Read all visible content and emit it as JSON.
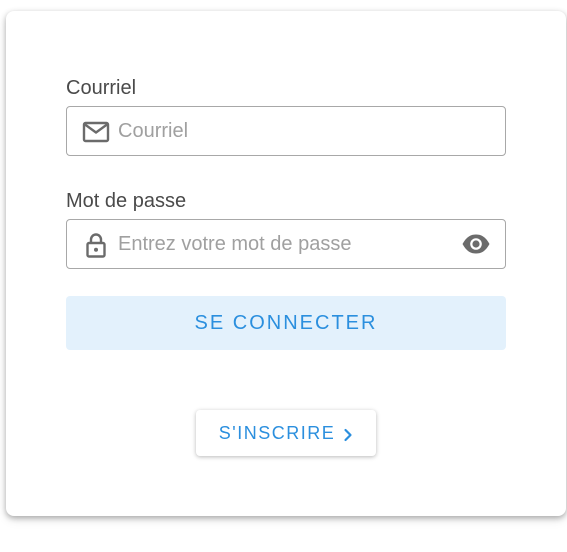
{
  "email": {
    "label": "Courriel",
    "placeholder": "Courriel",
    "value": "",
    "icon": "mail-icon"
  },
  "password": {
    "label": "Mot de passe",
    "placeholder": "Entrez votre mot de passe",
    "value": "",
    "icon": "lock-icon",
    "toggle_icon": "eye-icon"
  },
  "login_button": {
    "label": "SE CONNECTER"
  },
  "signup_button": {
    "label": "S'INSCRIRE",
    "icon": "chevron-right-icon"
  },
  "colors": {
    "accent": "#2b8fde",
    "primary_button_bg": "#e3f1fc",
    "icon": "#6b6b6b",
    "border": "#a8a8a8"
  }
}
